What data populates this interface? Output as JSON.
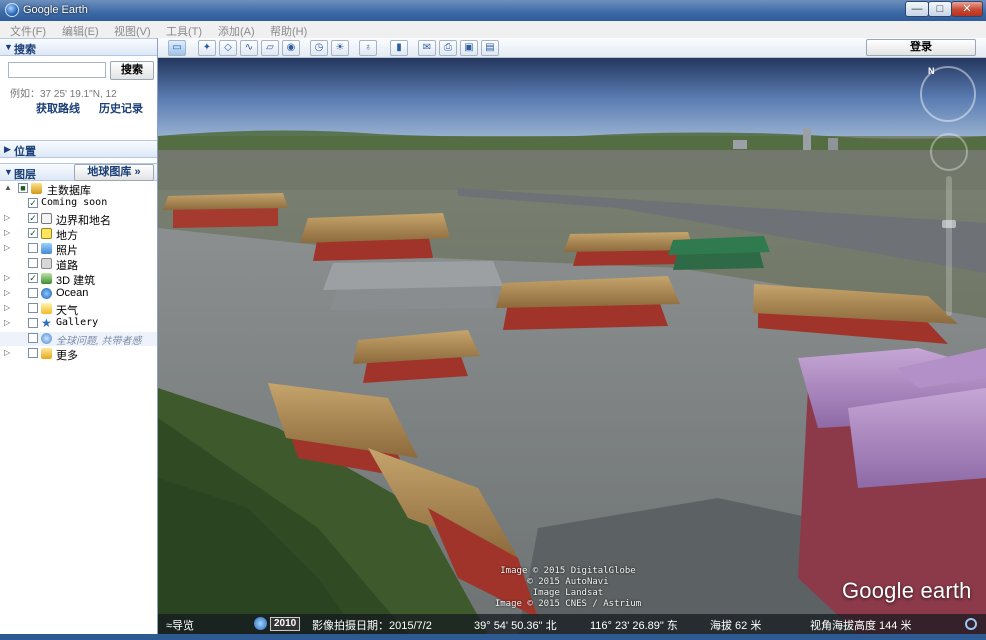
{
  "window": {
    "title": "Google Earth",
    "minimize": "—",
    "maximize": "□",
    "close": "✕"
  },
  "menu": [
    "文件(F)",
    "编辑(E)",
    "视图(V)",
    "工具(T)",
    "添加(A)",
    "帮助(H)"
  ],
  "search": {
    "header": "搜索",
    "input_value": "",
    "button": "搜索",
    "example": "例如：37 25' 19.1\"N, 12",
    "directions": "获取路线",
    "history": "历史记录"
  },
  "places": {
    "header": "位置"
  },
  "layers": {
    "header": "图层",
    "gallery_button": "地球图库 »",
    "items": [
      {
        "label": "主数据库",
        "checked": "■",
        "icon": "database-icon",
        "expand": "▲"
      },
      {
        "label": "Coming soon",
        "checked": "✓",
        "icon": "",
        "expand": ""
      },
      {
        "label": "边界和地名",
        "checked": "✓",
        "icon": "flag-icon",
        "expand": "▷"
      },
      {
        "label": "地方",
        "checked": "✓",
        "icon": "place-icon",
        "expand": "▷"
      },
      {
        "label": "照片",
        "checked": "",
        "icon": "photo-icon",
        "expand": "▷"
      },
      {
        "label": "道路",
        "checked": "",
        "icon": "road-icon",
        "expand": ""
      },
      {
        "label": "3D 建筑",
        "checked": "✓",
        "icon": "building-icon",
        "expand": "▷"
      },
      {
        "label": "Ocean",
        "checked": "",
        "icon": "ocean-icon",
        "expand": "▷"
      },
      {
        "label": "天气",
        "checked": "",
        "icon": "weather-icon",
        "expand": "▷"
      },
      {
        "label": "Gallery",
        "checked": "",
        "icon": "gallery-icon",
        "expand": "▷"
      },
      {
        "label": "全球问题, 共带者感",
        "checked": "",
        "icon": "globe-icon",
        "expand": ""
      },
      {
        "label": "更多",
        "checked": "",
        "icon": "more-icon",
        "expand": "▷"
      }
    ]
  },
  "toolbar": {
    "login": "登录"
  },
  "viewport": {
    "compass_n": "N",
    "attribution": [
      "Image © 2015 DigitalGlobe",
      "© 2015 AutoNavi",
      "Image Landsat",
      "Image © 2015 CNES / Astrium"
    ],
    "logo": "Google earth"
  },
  "status": {
    "nav": "≈导览",
    "year": "2010",
    "imagery_date": "影像拍摄日期：2015/7/2",
    "lat": "39° 54' 50.36\" 北",
    "lon": "116° 23' 26.89\" 东",
    "elevation": "海拔   62 米",
    "eye_alt": "视角海拔高度   144 米"
  }
}
